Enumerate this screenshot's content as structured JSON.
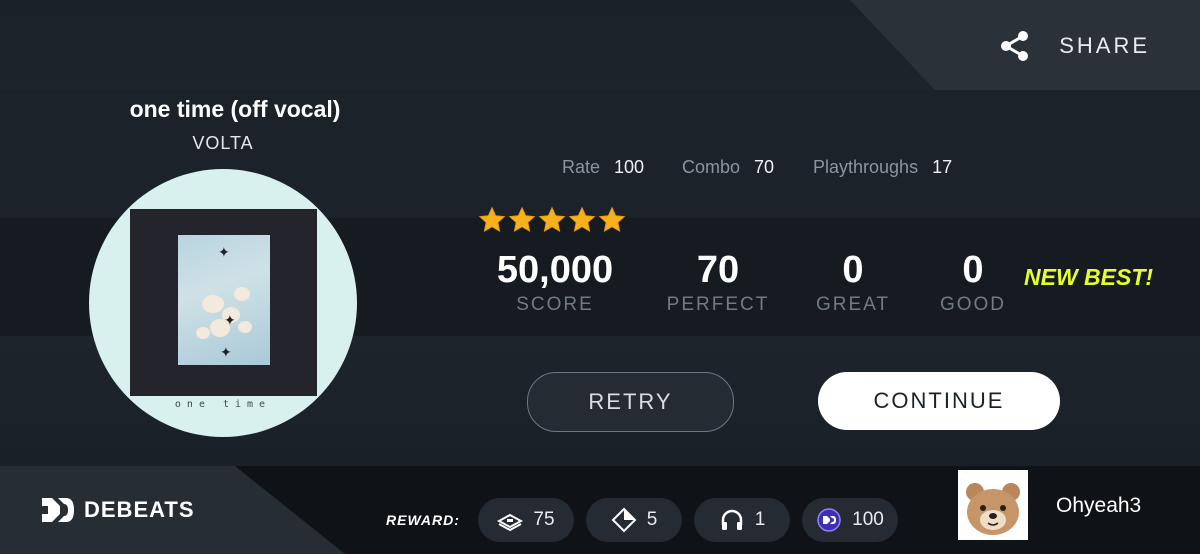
{
  "share": {
    "label": "SHARE",
    "icon": "share-icon"
  },
  "song": {
    "title": "one time (off vocal)",
    "artist": "VOLTA",
    "cover_caption": "one time"
  },
  "stats": [
    {
      "label": "Rate",
      "value": "100"
    },
    {
      "label": "Combo",
      "value": "70"
    },
    {
      "label": "Playthroughs",
      "value": "17"
    }
  ],
  "stars": 5,
  "results": [
    {
      "value": "50,000",
      "label": "SCORE"
    },
    {
      "value": "70",
      "label": "PERFECT"
    },
    {
      "value": "0",
      "label": "GREAT"
    },
    {
      "value": "0",
      "label": "GOOD"
    }
  ],
  "new_best": "NEW BEST!",
  "buttons": {
    "retry": "RETRY",
    "continue": "CONTINUE"
  },
  "footer": {
    "logo": "DEBEATS",
    "reward_label": "REWARD:",
    "rewards": [
      {
        "icon": "ticket-icon",
        "value": "75"
      },
      {
        "icon": "diamond-icon",
        "value": "5"
      },
      {
        "icon": "headphones-icon",
        "value": "1"
      },
      {
        "icon": "coin-icon",
        "value": "100"
      }
    ],
    "user": {
      "name": "Ohyeah3",
      "avatar": "bear-avatar"
    }
  },
  "colors": {
    "accent_new_best": "#e6ff2b",
    "star": "#f7b21b",
    "background": "#1b2229"
  }
}
